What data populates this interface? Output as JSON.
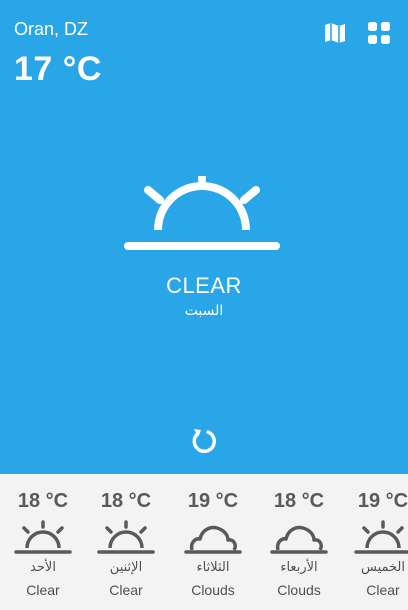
{
  "header": {
    "location": "Oran, DZ",
    "temperature": "17 °C",
    "map_icon": "map-icon",
    "grid_icon": "grid-icon"
  },
  "current": {
    "condition": "CLEAR",
    "day": "السبت",
    "icon": "sunrise-icon",
    "refresh_icon": "refresh-icon"
  },
  "forecast": [
    {
      "temp": "18 °C",
      "day": "الأحد",
      "condition": "Clear",
      "icon": "sun-icon"
    },
    {
      "temp": "18 °C",
      "day": "الإثنين",
      "condition": "Clear",
      "icon": "sun-icon"
    },
    {
      "temp": "19 °C",
      "day": "الثلاثاء",
      "condition": "Clouds",
      "icon": "cloud-icon"
    },
    {
      "temp": "18 °C",
      "day": "الأربعاء",
      "condition": "Clouds",
      "icon": "cloud-icon"
    },
    {
      "temp": "19 °C",
      "day": "الخميس",
      "condition": "Clear",
      "icon": "sun-icon"
    }
  ],
  "colors": {
    "primary": "#29a6e8",
    "forecast_background": "#f3f3f3",
    "forecast_text": "#555555"
  }
}
